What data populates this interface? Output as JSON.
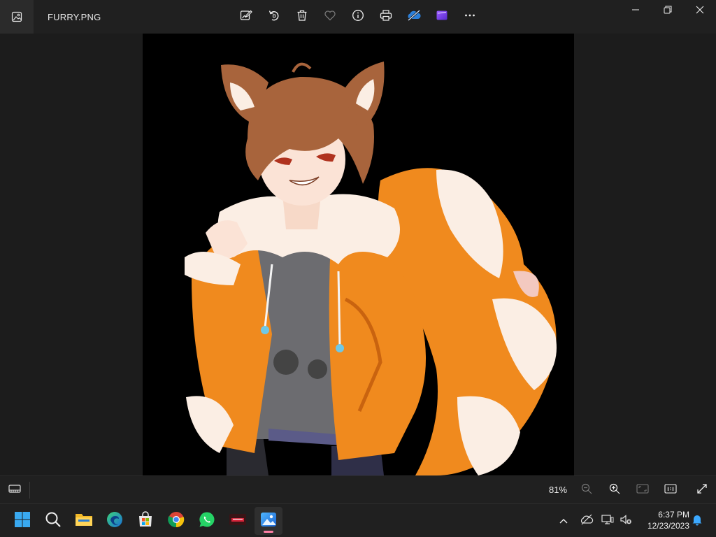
{
  "window": {
    "filename": "FURRY.PNG",
    "toolbar": [
      {
        "name": "edit-image-icon"
      },
      {
        "name": "rotate-icon"
      },
      {
        "name": "delete-icon"
      },
      {
        "name": "favorite-icon"
      },
      {
        "name": "info-icon"
      },
      {
        "name": "print-icon"
      },
      {
        "name": "onedrive-icon"
      },
      {
        "name": "clipchamp-icon"
      },
      {
        "name": "more-icon"
      }
    ],
    "controls": [
      "minimize",
      "restore",
      "close"
    ]
  },
  "statusbar": {
    "zoom": "81%"
  },
  "taskbar": {
    "apps": [
      "start",
      "search",
      "file-explorer",
      "edge",
      "store",
      "chrome",
      "whatsapp",
      "game",
      "photos"
    ],
    "clock": {
      "time": "6:37 PM",
      "date": "12/23/2023"
    }
  },
  "colors": {
    "accent": "#ff7fa6",
    "hoodie": "#f08a1e",
    "hair": "#a8643c"
  }
}
